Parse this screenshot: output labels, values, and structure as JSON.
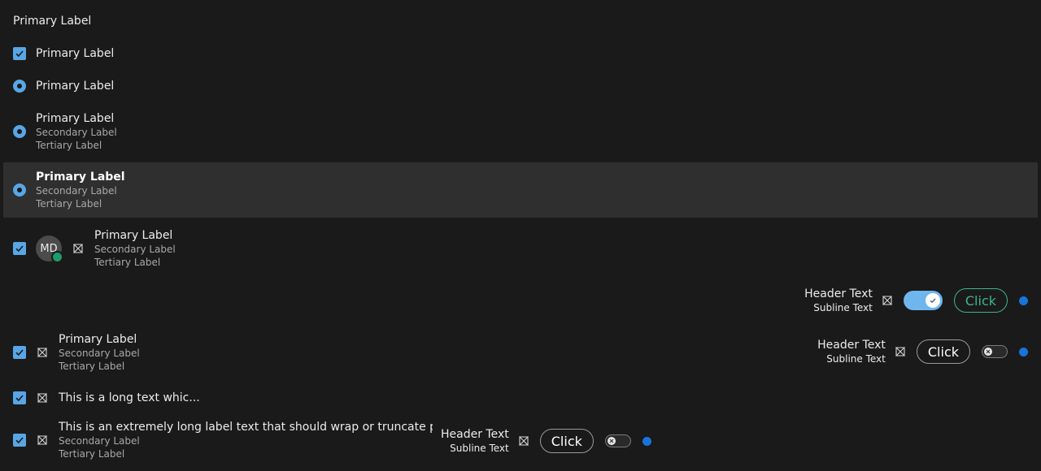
{
  "colors": {
    "background": "#1a1a1a",
    "selected_row": "#2f2f2f",
    "checkbox_accent": "#58a6e6",
    "presence_green": "#1f9a6a",
    "teal_button": "#3fb68b",
    "blue_indicator": "#1a73d9"
  },
  "rows": [
    {
      "primary": "Primary Label"
    },
    {
      "primary": "Primary Label",
      "leading": "checkbox-checked"
    },
    {
      "primary": "Primary Label",
      "leading": "radio-selected"
    },
    {
      "primary": "Primary Label",
      "secondary": "Secondary Label",
      "tertiary": "Tertiary Label",
      "leading": "radio-selected"
    },
    {
      "primary": "Primary Label",
      "secondary": "Secondary Label",
      "tertiary": "Tertiary Label",
      "leading": "radio-selected",
      "selected": true
    },
    {
      "primary": "Primary Label",
      "secondary": "Secondary Label",
      "tertiary": "Tertiary Label",
      "leading": "checkbox-checked",
      "avatar_initials": "MD",
      "avatar_status": "online",
      "icon": "cross-x-icon"
    },
    {
      "trailing": {
        "header": "Header Text",
        "subline": "Subline Text",
        "icon": "cross-x-icon",
        "toggle_on": true,
        "button_label": "Click",
        "indicator": "blue-dot"
      }
    },
    {
      "primary": "Primary Label",
      "secondary": "Secondary Label",
      "tertiary": "Tertiary Label",
      "leading": "checkbox-checked",
      "icon": "cross-x-icon",
      "trailing": {
        "header": "Header Text",
        "subline": "Subline Text",
        "icon": "cross-x-icon",
        "button_label": "Click",
        "toggle_on": false,
        "indicator": "blue-dot"
      }
    },
    {
      "primary": "This is a long text whic...",
      "leading": "checkbox-checked",
      "icon": "cross-x-icon"
    },
    {
      "primary": "This is an extremely long label text that should wrap or truncate prope...",
      "secondary": "Secondary Label",
      "tertiary": "Tertiary Label",
      "leading": "checkbox-checked",
      "icon": "cross-x-icon",
      "trailing": {
        "header": "Header Text",
        "subline": "Subline Text",
        "icon": "cross-x-icon",
        "button_label": "Click",
        "toggle_on": false,
        "indicator": "blue-dot"
      }
    }
  ]
}
